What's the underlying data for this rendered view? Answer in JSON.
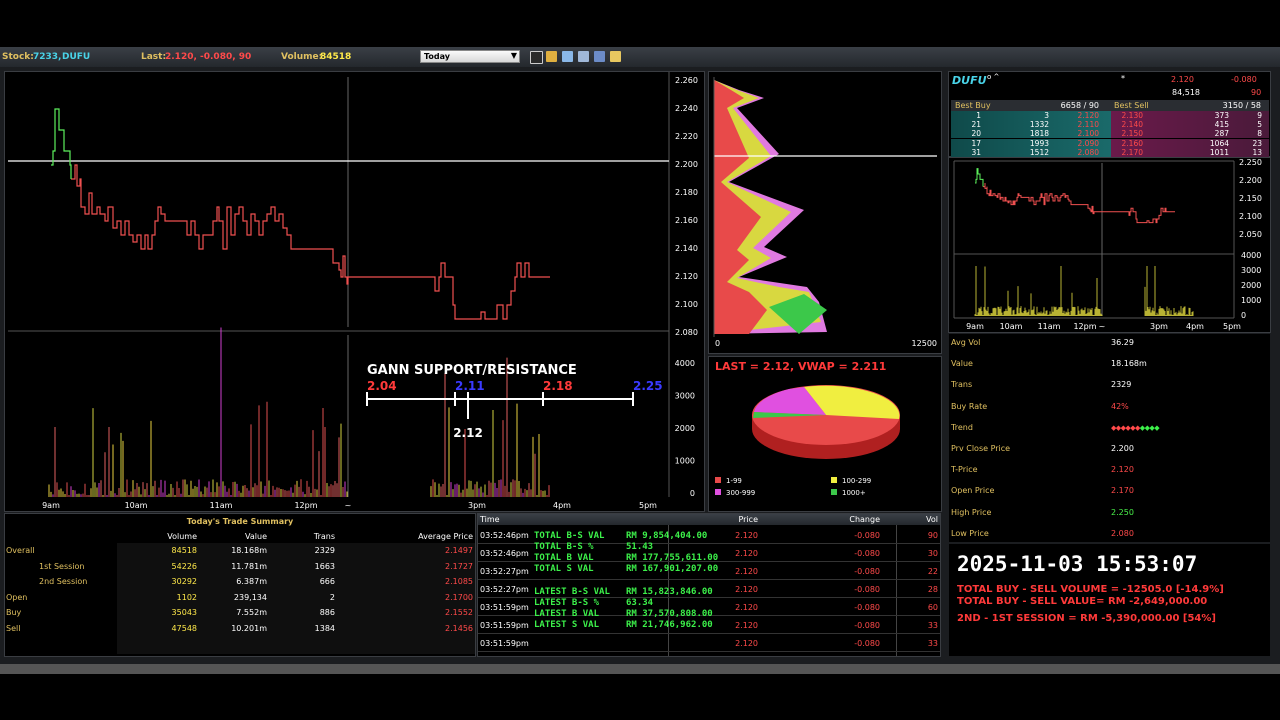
{
  "toolbar": {
    "stock_label": "Stock:",
    "stock_code": "7233,",
    "stock_name": "DUFU",
    "last_label": "Last:",
    "last_value": "2.120, -0.080, 90",
    "volume_label": "Volume:",
    "volume_value": "84518",
    "period": "Today"
  },
  "price_axis": [
    "2.260",
    "2.240",
    "2.220",
    "2.200",
    "2.180",
    "2.160",
    "2.140",
    "2.120",
    "2.100",
    "2.080"
  ],
  "volume_axis": [
    "4000",
    "3000",
    "2000",
    "1000",
    "0"
  ],
  "time_axis": [
    "9am",
    "10am",
    "11am",
    "12pm",
    "~",
    "3pm",
    "4pm",
    "5pm"
  ],
  "gann": {
    "title": "GANN SUPPORT/RESISTANCE",
    "levels": [
      "2.04",
      "2.11",
      "2.18",
      "2.25"
    ],
    "current": "2.12"
  },
  "volume_profile": {
    "axis_min": "0",
    "axis_max": "12500"
  },
  "pie": {
    "title": "LAST = 2.12, VWAP = 2.211",
    "legend": [
      {
        "label": "1-99",
        "color": "#e84a4a"
      },
      {
        "label": "100-299",
        "color": "#f0ee40"
      },
      {
        "label": "300-999",
        "color": "#e050e0"
      },
      {
        "label": "1000+",
        "color": "#3cc84a"
      }
    ]
  },
  "trade_summary": {
    "title": "Today's Trade Summary",
    "headers": [
      "",
      "Volume",
      "Value",
      "Trans",
      "Average Price"
    ],
    "rows": [
      [
        "Overall",
        "84518",
        "18.168m",
        "2329",
        "2.1497"
      ],
      [
        "1st Session",
        "54226",
        "11.781m",
        "1663",
        "2.1727"
      ],
      [
        "2nd Session",
        "30292",
        "6.387m",
        "666",
        "2.1085"
      ],
      [
        "Open",
        "1102",
        "239,134",
        "2",
        "2.1700"
      ],
      [
        "Buy",
        "35043",
        "7.552m",
        "886",
        "2.1552"
      ],
      [
        "Sell",
        "47548",
        "10.201m",
        "1384",
        "2.1456"
      ]
    ]
  },
  "time_sales": {
    "headers": [
      "Time",
      "Price",
      "Change",
      "Vol"
    ],
    "rows": [
      [
        "03:52:46pm",
        "2.120",
        "-0.080",
        "90"
      ],
      [
        "03:52:46pm",
        "2.120",
        "-0.080",
        "30"
      ],
      [
        "03:52:27pm",
        "2.120",
        "-0.080",
        "22"
      ],
      [
        "03:52:27pm",
        "2.120",
        "-0.080",
        "28"
      ],
      [
        "03:51:59pm",
        "2.120",
        "-0.080",
        "60"
      ],
      [
        "03:51:59pm",
        "2.120",
        "-0.080",
        "33"
      ],
      [
        "03:51:59pm",
        "2.120",
        "-0.080",
        "33"
      ]
    ],
    "overlay": [
      [
        "TOTAL B-S VAL",
        "RM 9,854,404.00"
      ],
      [
        "TOTAL B-S %",
        "51.43"
      ],
      [
        "TOTAL B VAL",
        "RM 177,755,611.00"
      ],
      [
        "TOTAL S VAL",
        "RM 167,901,207.00"
      ],
      [
        "LATEST B-S VAL",
        "RM 15,823,846.00"
      ],
      [
        "LATEST B-S %",
        "63.34"
      ],
      [
        "LATEST B VAL",
        "RM 37,570,808.00"
      ],
      [
        "LATEST S VAL",
        "RM 21,746,962.00"
      ]
    ]
  },
  "quote": {
    "name": "DUFU",
    "superscript": "o ^",
    "star": "*",
    "last": "2.120",
    "change": "-0.080",
    "volume": "84,518",
    "last_vol": "90",
    "best_buy_label": "Best Buy",
    "best_buy_value": "6658 / 90",
    "best_sell_label": "Best Sell",
    "best_sell_value": "3150 / 58",
    "depth": [
      [
        "1",
        "3",
        "2.120",
        "2.130",
        "373",
        "9"
      ],
      [
        "21",
        "1332",
        "2.110",
        "2.140",
        "415",
        "5"
      ],
      [
        "20",
        "1818",
        "2.100",
        "2.150",
        "287",
        "8"
      ],
      [
        "17",
        "1993",
        "2.090",
        "2.160",
        "1064",
        "23"
      ],
      [
        "31",
        "1512",
        "2.080",
        "2.170",
        "1011",
        "13"
      ]
    ]
  },
  "mini_chart": {
    "price_axis": [
      "2.250",
      "2.200",
      "2.150",
      "2.100",
      "2.050"
    ],
    "volume_axis": [
      "4000",
      "3000",
      "2000",
      "1000",
      "0"
    ],
    "time_axis": [
      "9am",
      "10am",
      "11am",
      "12pm",
      "~",
      "3pm",
      "4pm",
      "5pm"
    ]
  },
  "stats": [
    {
      "label": "Avg Vol",
      "value": "36.29",
      "color": "#ffffff"
    },
    {
      "label": "Value",
      "value": "18.168m",
      "color": "#ffffff"
    },
    {
      "label": "Trans",
      "value": "2329",
      "color": "#ffffff"
    },
    {
      "label": "Buy Rate",
      "value": "42%",
      "color": "#ff4a4a"
    },
    {
      "label": "Trend",
      "value": "",
      "color": "#ffffff"
    },
    {
      "label": "Prv Close Price",
      "value": "2.200",
      "color": "#ffffff"
    },
    {
      "label": "T-Price",
      "value": "2.120",
      "color": "#ff4a4a"
    },
    {
      "label": "Open Price",
      "value": "2.170",
      "color": "#ff4a4a"
    },
    {
      "label": "High Price",
      "value": "2.250",
      "color": "#49f04a"
    },
    {
      "label": "Low Price",
      "value": "2.080",
      "color": "#ff4a4a"
    }
  ],
  "overlay_info": {
    "datetime": "2025-11-03 15:53:07",
    "lines": [
      "TOTAL BUY - SELL VOLUME = -12505.0 [-14.9%]",
      "TOTAL BUY - SELL VALUE= RM -2,649,000.00",
      "2ND - 1ST SESSION = RM -5,390,000.00 [54%]"
    ]
  },
  "colors": {
    "up": "#49f04a",
    "down": "#ff4a4a",
    "label": "#e0c060",
    "cyan": "#49d3e8"
  }
}
